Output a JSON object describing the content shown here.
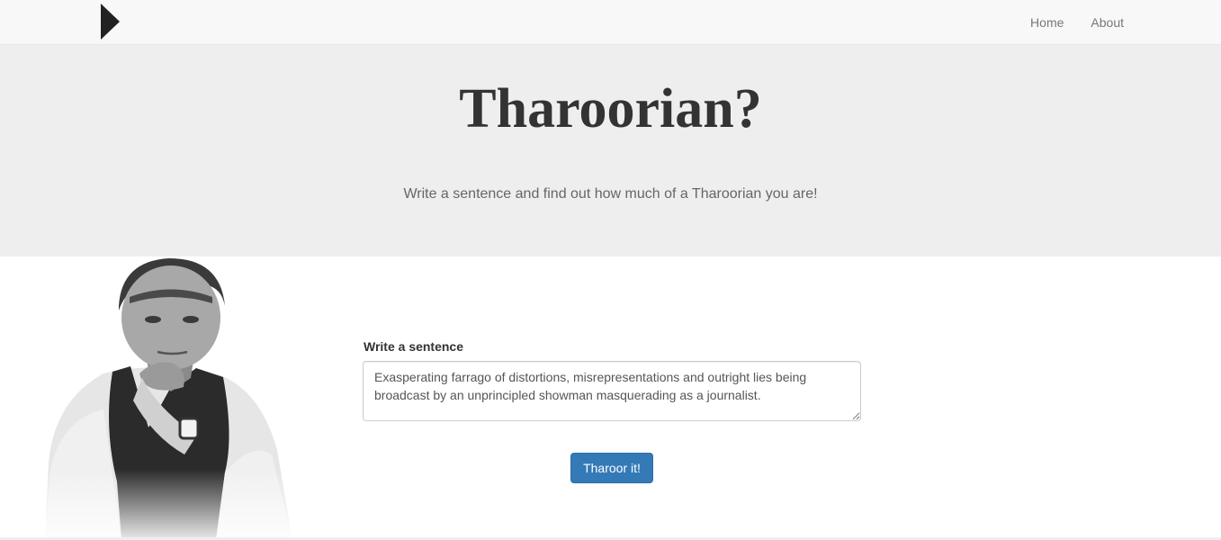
{
  "navbar": {
    "brand_icon": "play-triangle-icon",
    "links": [
      "Home",
      "About"
    ]
  },
  "hero": {
    "title": "Tharoorian?",
    "subtitle": "Write a sentence and find out how much of a Tharoorian you are!"
  },
  "form": {
    "label": "Write a sentence",
    "input_value": "Exasperating farrago of distortions, misrepresentations and outright lies being broadcast by an unprincipled showman masquerading as a journalist.",
    "submit_label": "Tharoor it!"
  },
  "colors": {
    "navbar_bg": "#f8f8f8",
    "hero_bg": "#eeeeee",
    "primary_button": "#337ab7"
  }
}
